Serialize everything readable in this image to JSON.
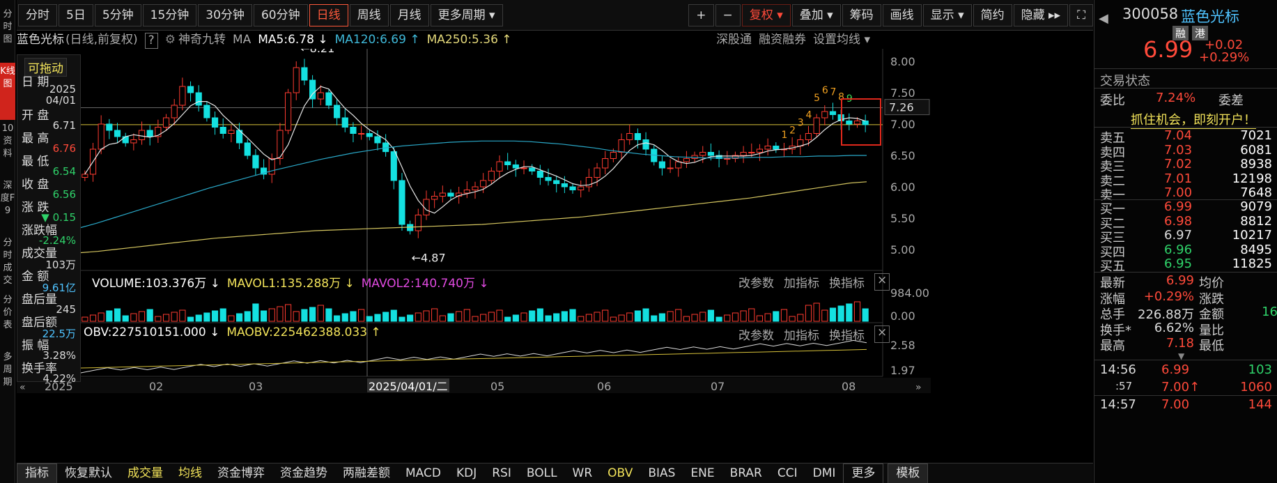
{
  "left_strip": [
    {
      "label": "分时图",
      "active": false
    },
    {
      "label": "K线图",
      "active": true
    },
    {
      "label": "10资料",
      "active": false
    },
    {
      "label": "深度F9",
      "active": false
    },
    {
      "label": "分时成交",
      "active": false
    },
    {
      "label": "分价表",
      "active": false
    },
    {
      "label": "多周期",
      "active": false
    }
  ],
  "toolbar": {
    "periods": [
      "分时",
      "5日",
      "5分钟",
      "15分钟",
      "30分钟",
      "60分钟",
      "日线",
      "周线",
      "月线",
      "更多周期 ▾"
    ],
    "active_period": "日线",
    "tools": [
      "+",
      "−",
      "复权 ▾",
      "叠加 ▾",
      "筹码",
      "画线",
      "显示 ▾",
      "简约",
      "隐藏 ▸▸",
      "⛶"
    ]
  },
  "info": {
    "name": "蓝色光标",
    "mode": "(日线,前复权)",
    "help": "?",
    "indicator": "神奇九转",
    "ma": "MA",
    "ma5": "MA5:6.78 ↓",
    "ma120": "MA120:6.69 ↑",
    "ma250": "MA250:5.36 ↑",
    "links": [
      "深股通",
      "融资融券",
      "设置均线 ▾"
    ]
  },
  "panel": {
    "drag": "可拖动",
    "rows": [
      {
        "label": "日 期",
        "value": "2025\n04/01",
        "color": "#ddd"
      },
      {
        "label": "开 盘",
        "value": "6.71",
        "color": "#ddd"
      },
      {
        "label": "最 高",
        "value": "6.76",
        "color": "#ff4a3a"
      },
      {
        "label": "最 低",
        "value": "6.54",
        "color": "#2fd36a"
      },
      {
        "label": "收 盘",
        "value": "6.56",
        "color": "#2fd36a"
      },
      {
        "label": "涨 跌",
        "value": "▼ 0.15",
        "color": "#2fd36a"
      },
      {
        "label": "涨跌幅",
        "value": "-2.24%",
        "color": "#2fd36a"
      },
      {
        "label": "成交量",
        "value": "103万",
        "color": "#ddd"
      },
      {
        "label": "金 额",
        "value": "9.61亿",
        "color": "#4fc3ff"
      },
      {
        "label": "盘后量",
        "value": "245",
        "color": "#ddd"
      },
      {
        "label": "盘后额",
        "value": "22.5万",
        "color": "#4fc3ff"
      },
      {
        "label": "振 幅",
        "value": "3.28%",
        "color": "#ddd"
      },
      {
        "label": "换手率",
        "value": "4.22%",
        "color": "#ddd"
      }
    ]
  },
  "chart_data": {
    "type": "candlestick",
    "y_ticks": [
      "8.00",
      "7.50",
      "7.00",
      "6.50",
      "6.00",
      "5.50",
      "5.00"
    ],
    "y_range": [
      4.8,
      8.2
    ],
    "current_price": "7.26",
    "x_labels": [
      "2025",
      "02",
      "03",
      "2025/04/01/二",
      "05",
      "06",
      "07",
      "08"
    ],
    "annotations": {
      "high": "8.21",
      "low": "4.87"
    },
    "nine_turn": [
      "1",
      "2",
      "3",
      "4",
      "5",
      "6",
      "7",
      "8",
      "9"
    ],
    "closes": [
      6.2,
      6.6,
      7.0,
      6.9,
      6.8,
      6.7,
      6.75,
      6.9,
      6.8,
      6.95,
      7.1,
      7.3,
      7.6,
      7.5,
      7.3,
      7.1,
      6.95,
      6.85,
      6.9,
      6.7,
      6.5,
      6.3,
      6.2,
      6.45,
      6.9,
      7.5,
      7.9,
      7.7,
      7.4,
      7.5,
      7.3,
      7.1,
      6.95,
      6.85,
      6.85,
      6.8,
      6.7,
      6.56,
      6.1,
      5.4,
      5.3,
      5.55,
      5.8,
      5.85,
      5.9,
      5.85,
      5.9,
      5.95,
      6.0,
      6.1,
      6.25,
      6.4,
      6.35,
      6.3,
      6.3,
      6.25,
      6.15,
      6.1,
      6.05,
      6.0,
      5.95,
      6.0,
      6.15,
      6.3,
      6.45,
      6.55,
      6.75,
      6.85,
      6.75,
      6.6,
      6.4,
      6.3,
      6.3,
      6.4,
      6.45,
      6.5,
      6.55,
      6.5,
      6.45,
      6.45,
      6.5,
      6.55,
      6.55,
      6.6,
      6.65,
      6.6,
      6.6,
      6.65,
      6.75,
      6.85,
      7.1,
      7.2,
      7.15,
      7.05,
      7.0,
      7.05,
      6.99
    ],
    "ma120": [
      5.35,
      5.42,
      5.5,
      5.58,
      5.66,
      5.74,
      5.82,
      5.9,
      5.98,
      6.05,
      6.12,
      6.19,
      6.26,
      6.32,
      6.38,
      6.44,
      6.49,
      6.54,
      6.58,
      6.62,
      6.65,
      6.67,
      6.69,
      6.71,
      6.72,
      6.73,
      6.73,
      6.73,
      6.72,
      6.7,
      6.68,
      6.65,
      6.62,
      6.58,
      6.55,
      6.52,
      6.5,
      6.48,
      6.47,
      6.46,
      6.46,
      6.46,
      6.47,
      6.47,
      6.48,
      6.48,
      6.49,
      6.49,
      6.5,
      6.5
    ],
    "ma250": [
      4.95,
      4.97,
      5.0,
      5.03,
      5.06,
      5.09,
      5.12,
      5.15,
      5.18,
      5.2,
      5.22,
      5.24,
      5.26,
      5.28,
      5.3,
      5.31,
      5.32,
      5.33,
      5.34,
      5.35,
      5.36,
      5.37,
      5.38,
      5.39,
      5.4,
      5.42,
      5.44,
      5.46,
      5.48,
      5.5,
      5.52,
      5.55,
      5.58,
      5.61,
      5.64,
      5.67,
      5.7,
      5.73,
      5.76,
      5.79,
      5.82,
      5.86,
      5.9,
      5.94,
      5.98,
      6.02,
      6.06,
      6.08
    ],
    "volume": {
      "label": "VOLUME:103.376万 ↓",
      "mavol1": "MAVOL1:135.288万 ↓",
      "mavol2": "MAVOL2:140.740万 ↓",
      "ticks": [
        "984.00",
        "0.00"
      ]
    },
    "obv": {
      "label": "OBV:227510151.000 ↓",
      "maobv": "MAOBV:225462388.033 ↑",
      "ticks": [
        "2.58",
        "1.97"
      ]
    }
  },
  "sub_controls": [
    "改参数",
    "加指标",
    "换指标",
    "×"
  ],
  "right": {
    "code": "300058",
    "name": "蓝色光标",
    "tags": [
      "融",
      "港"
    ],
    "price": "6.99",
    "chg": "+0.02",
    "pct": "+0.29%",
    "state": "交易状态",
    "weibi_label": "委比",
    "weibi": "7.24%",
    "weicha_label": "委差",
    "promo": "抓住机会，即刻开户！",
    "asks": [
      {
        "l": "卖五",
        "p": "7.04",
        "v": "7021"
      },
      {
        "l": "卖四",
        "p": "7.03",
        "v": "6081"
      },
      {
        "l": "卖三",
        "p": "7.02",
        "v": "8938"
      },
      {
        "l": "卖二",
        "p": "7.01",
        "v": "12198"
      },
      {
        "l": "卖一",
        "p": "7.00",
        "v": "7648"
      }
    ],
    "bids": [
      {
        "l": "买一",
        "p": "6.99",
        "v": "9079",
        "c": "#ff4a3a"
      },
      {
        "l": "买二",
        "p": "6.98",
        "v": "8812",
        "c": "#ff4a3a"
      },
      {
        "l": "买三",
        "p": "6.97",
        "v": "10217",
        "c": "#ddd"
      },
      {
        "l": "买四",
        "p": "6.96",
        "v": "8495",
        "c": "#2fd36a"
      },
      {
        "l": "买五",
        "p": "6.95",
        "v": "11825",
        "c": "#2fd36a"
      }
    ],
    "stats": [
      {
        "l": "最新",
        "v": "6.99",
        "c": "#ff4a3a",
        "l2": "均价",
        "v2": ""
      },
      {
        "l": "涨幅",
        "v": "+0.29%",
        "c": "#ff4a3a",
        "l2": "涨跌",
        "v2": ""
      },
      {
        "l": "总手",
        "v": "226.88万",
        "c": "#ddd",
        "l2": "金额",
        "v2": "16"
      },
      {
        "l": "换手*",
        "v": "6.62%",
        "c": "#ddd",
        "l2": "量比",
        "v2": ""
      },
      {
        "l": "最高",
        "v": "7.18",
        "c": "#ff4a3a",
        "l2": "最低",
        "v2": ""
      }
    ],
    "ticks": [
      {
        "t": "14:56",
        "p": "6.99",
        "v": "103",
        "vc": "#2fd36a"
      },
      {
        "t": ":57",
        "p": "7.00↑",
        "v": "1060",
        "vc": "#ff4a3a"
      },
      {
        "t": "14:57",
        "p": "7.00",
        "v": "144",
        "vc": "#ff4a3a"
      }
    ]
  },
  "bottom": {
    "items": [
      "指标",
      "恢复默认",
      "成交量",
      "均线",
      "资金博弈",
      "资金趋势",
      "两融差额",
      "MACD",
      "KDJ",
      "RSI",
      "BOLL",
      "WR",
      "OBV",
      "BIAS",
      "ENE",
      "BRAR",
      "CCI",
      "DMI",
      "更多",
      "模板"
    ]
  }
}
